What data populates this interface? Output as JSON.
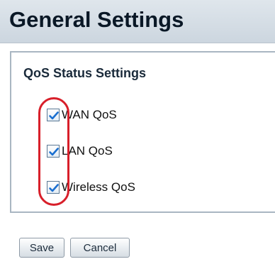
{
  "page": {
    "title": "General Settings"
  },
  "qos": {
    "section_title": "QoS Status Settings",
    "options": [
      {
        "label": "WAN QoS",
        "checked": true
      },
      {
        "label": "LAN QoS",
        "checked": true
      },
      {
        "label": "Wireless QoS",
        "checked": true
      }
    ]
  },
  "buttons": {
    "save_label": "Save",
    "cancel_label": "Cancel"
  },
  "colors": {
    "header_bg": "#ccd6df",
    "highlight": "#d81f2a",
    "checkmark": "#1a6fd0"
  }
}
